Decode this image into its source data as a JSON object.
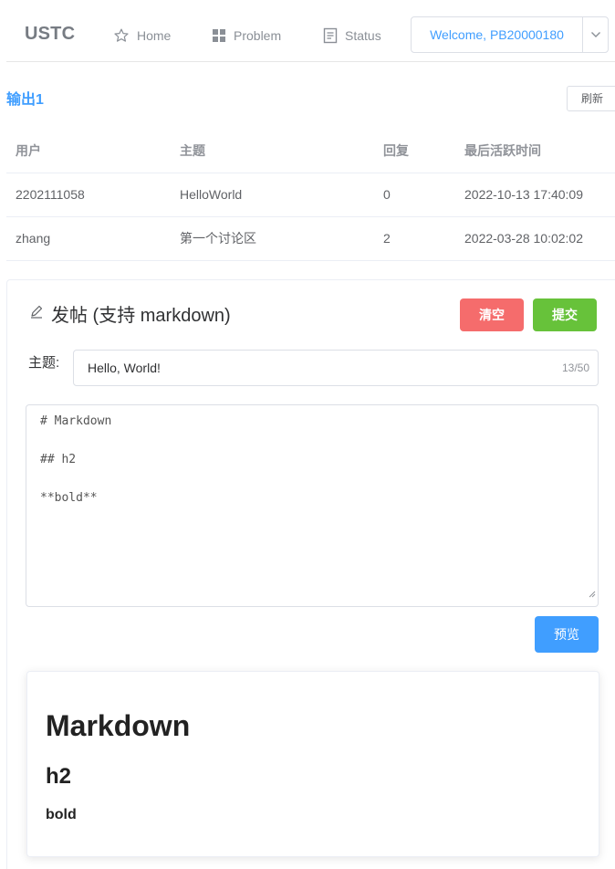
{
  "nav": {
    "brand": "USTC",
    "items": [
      {
        "label": "Home",
        "icon": "star-icon"
      },
      {
        "label": "Problem",
        "icon": "grid-icon"
      },
      {
        "label": "Status",
        "icon": "document-icon"
      }
    ],
    "welcome": "Welcome, PB20000180"
  },
  "section": {
    "title": "输出1",
    "refresh_label": "刷新"
  },
  "table": {
    "headers": [
      "用户",
      "主题",
      "回复",
      "最后活跃时间"
    ],
    "rows": [
      [
        "2202111058",
        "HelloWorld",
        "0",
        "2022-10-13 17:40:09"
      ],
      [
        "zhang",
        "第一个讨论区",
        "2",
        "2022-03-28 10:02:02"
      ]
    ]
  },
  "post": {
    "title": "发帖 (支持 markdown)",
    "clear_label": "清空",
    "submit_label": "提交",
    "subject_label": "主题:",
    "subject_value": "Hello, World!",
    "subject_count": "13/50",
    "editor_lines": [
      "# Markdown",
      "",
      "## h2",
      "",
      "**bold**"
    ],
    "preview_label": "预览"
  },
  "preview": {
    "h1": "Markdown",
    "h2": "h2",
    "bold": "bold"
  },
  "colors": {
    "primary": "#409eff",
    "danger": "#f56c6c",
    "success": "#67c23a",
    "border": "#dcdfe6"
  }
}
